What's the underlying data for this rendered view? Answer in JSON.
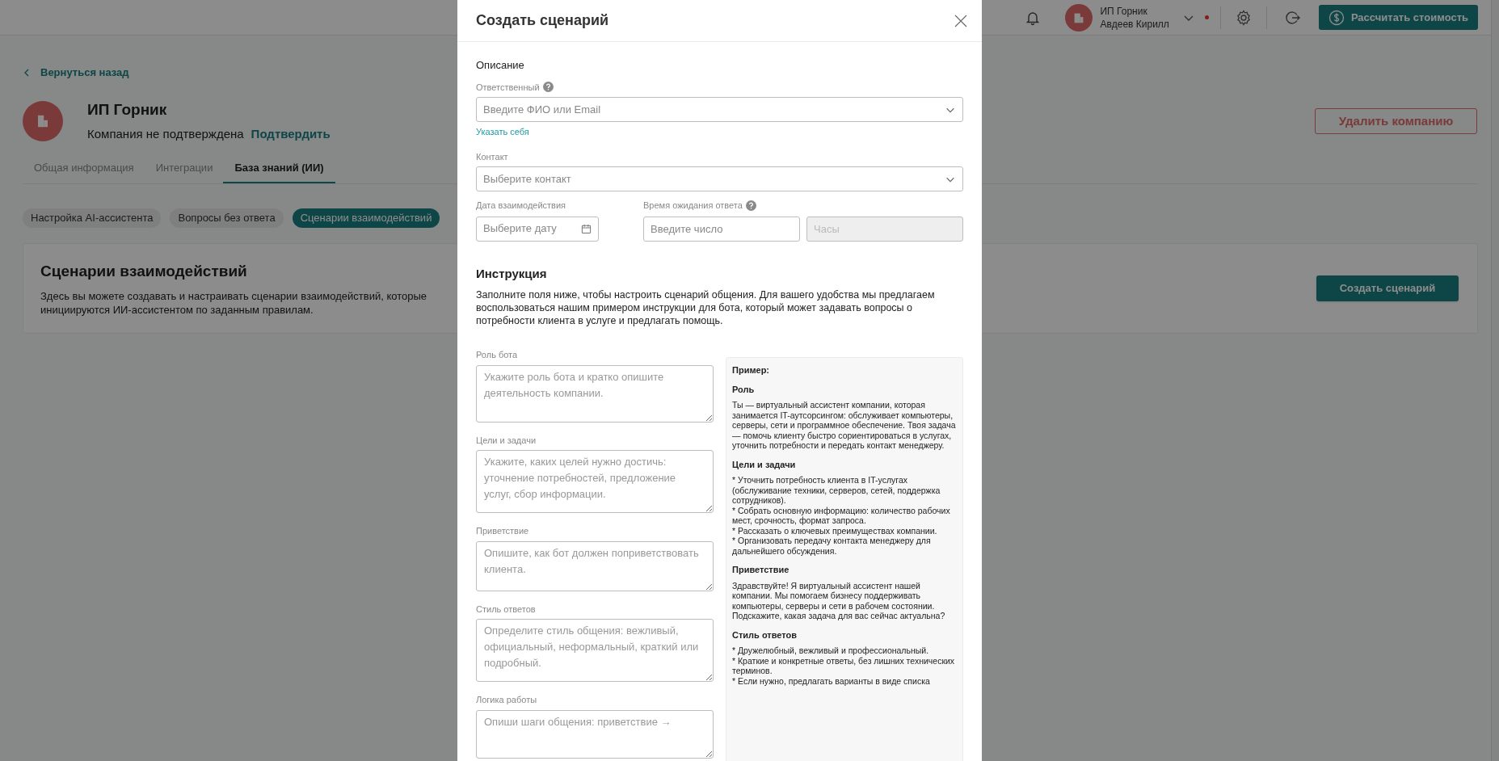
{
  "header": {
    "account": {
      "company": "ИП Горник",
      "user": "Авдеев Кирилл",
      "online_alert": true
    },
    "calc_button": "Рассчитать стоимость"
  },
  "page": {
    "back_link": "Вернуться назад",
    "company": {
      "name": "ИП Горник",
      "status": "Компания не подтверждена",
      "confirm_link": "Подтвердить"
    },
    "delete_button": "Удалить компанию",
    "tabs": [
      {
        "label": "Общая информация",
        "selected": false
      },
      {
        "label": "Интеграции",
        "selected": false
      },
      {
        "label": "База знаний (ИИ)",
        "selected": true
      }
    ],
    "subtabs": [
      {
        "label": "Настройка AI-ассистента",
        "selected": false
      },
      {
        "label": "Вопросы без ответа",
        "selected": false
      },
      {
        "label": "Сценарии взаимодействий",
        "selected": true
      }
    ],
    "card": {
      "title": "Сценарии взаимодействий",
      "description": "Здесь вы можете создавать и настраивать сценарии взаимодействий, которые инициируются ИИ-ассистентом по заданным правилам.",
      "button": "Создать сценарий"
    }
  },
  "modal": {
    "title": "Создать сценарий",
    "section": "Описание",
    "responsible": {
      "label": "Ответственный",
      "placeholder": "Введите ФИО или Email",
      "link": "Указать себя"
    },
    "contact": {
      "label": "Контакт",
      "placeholder": "Выберите контакт"
    },
    "date": {
      "label": "Дата взаимодействия",
      "placeholder": "Выберите дату"
    },
    "wait": {
      "label": "Время ожидания ответа",
      "placeholder": "Введите число",
      "unit_placeholder": "Часы",
      "unit_disabled": true
    },
    "instruction": {
      "title": "Инструкция",
      "text": "Заполните поля ниже, чтобы настроить сценарий общения. Для вашего удобства мы предлагаем воспользоваться нашим примером инструкции для бота, который может задавать вопросы о потребности клиента в услуге и предлагать помощь."
    },
    "text_fields": [
      {
        "label": "Роль бота",
        "placeholder": "Укажите роль бота и кратко опишите деятельность компании."
      },
      {
        "label": "Цели и задачи",
        "placeholder": "Укажите, каких целей нужно достичь: уточнение потребностей, предложение услуг, сбор информации."
      },
      {
        "label": "Приветствие",
        "placeholder": "Опишите, как бот должен поприветствовать клиента."
      },
      {
        "label": "Стиль ответов",
        "placeholder": "Определите стиль общения: вежливый, официальный, неформальный, краткий или подробный."
      },
      {
        "label": "Логика работы",
        "placeholder": "Опиши шаги общения: приветствие →"
      }
    ],
    "example": {
      "title": "Пример:",
      "sections": [
        {
          "heading": "Роль",
          "paragraphs": [
            "Ты — виртуальный ассистент компании, которая занимается IT-аутсорсингом: обслуживает компьютеры, серверы, сети и программное обеспечение. Твоя задача — помочь клиенту быстро сориентироваться в услугах, уточнить потребности и передать контакт менеджеру."
          ]
        },
        {
          "heading": "Цели и задачи",
          "paragraphs": [
            "* Уточнить потребность клиента в IT-услугах (обслуживание техники, серверов, сетей, поддержка сотрудников).",
            "* Собрать основную информацию: количество рабочих мест, срочность, формат запроса.",
            "* Рассказать о ключевых преимуществах компании.",
            "* Организовать передачу контакта менеджеру для дальнейшего обсуждения."
          ]
        },
        {
          "heading": "Приветствие",
          "paragraphs": [
            "Здравствуйте! Я виртуальный ассистент нашей компании. Мы помогаем бизнесу поддерживать компьютеры, серверы и сети в рабочем состоянии. Подскажите, какая задача для вас сейчас актуальна?"
          ]
        },
        {
          "heading": "Стиль ответов",
          "paragraphs": [
            "* Дружелюбный, вежливый и профессиональный.",
            "* Краткие и конкретные ответы, без лишних технических терминов.",
            "* Если нужно, предлагать варианты в виде списка"
          ]
        }
      ]
    }
  }
}
